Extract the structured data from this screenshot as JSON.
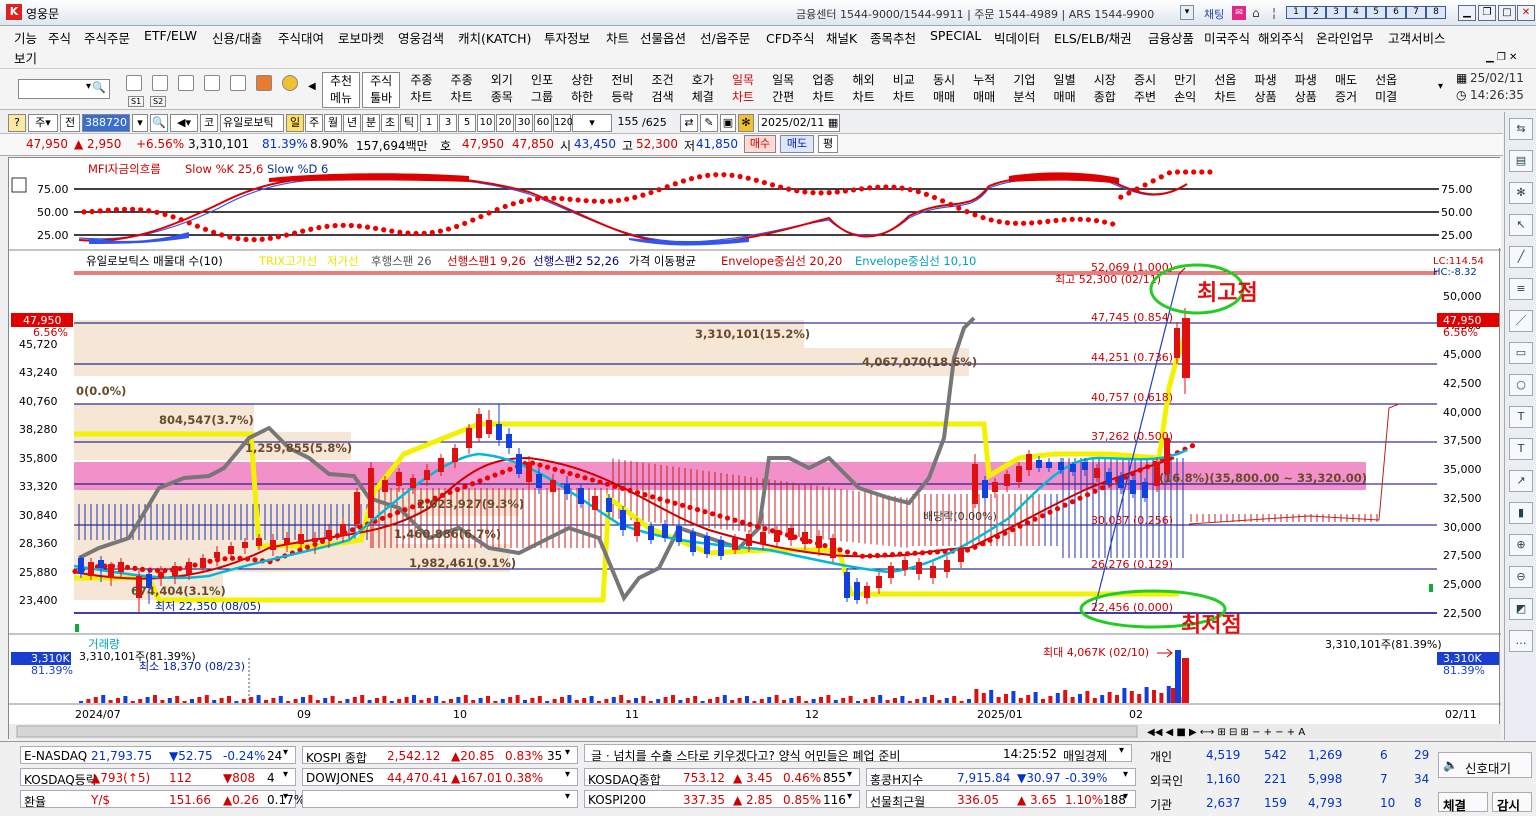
{
  "window": {
    "title": "영웅문",
    "info": "금융센터 1544-9000/1544-9911 | 주문 1544-4989 | ARS 1544-9900",
    "chat": "채팅",
    "num_buttons": [
      "1",
      "2",
      "3",
      "4",
      "5",
      "6",
      "7",
      "8"
    ]
  },
  "menu": {
    "items": [
      "기능",
      "주식",
      "주식주문",
      "ETF/ELW",
      "신용/대출",
      "주식대여",
      "로보마켓",
      "영웅검색",
      "캐치(KATCH)",
      "투자정보",
      "차트",
      "선물옵션",
      "선/옵주문",
      "CFD주식",
      "채널K",
      "종목추천",
      "SPECIAL",
      "빅데이터",
      "ELS/ELB/채권",
      "금융상품",
      "미국주식",
      "해외주식",
      "온라인업무",
      "고객서비스"
    ],
    "second": "보기"
  },
  "toolbar": {
    "small_labels": [
      "S1",
      "S2"
    ],
    "buttons": [
      "추천\n메뉴",
      "주식\n툴바",
      "주종\n차트",
      "주종\n차트",
      "외기\n종목",
      "인포\n그룹",
      "상한\n하한",
      "전비\n등락",
      "조건\n검색",
      "호가\n체결",
      "일목\n차트",
      "일목\n간편",
      "업종\n차트",
      "해외\n차트",
      "비교\n차트",
      "동시\n매매",
      "누적\n매매",
      "기업\n분석",
      "일별\n매매",
      "시장\n종합",
      "증시\n주변",
      "만기\n손익",
      "선옵\n차트",
      "파생\n상품",
      "파생\n상품",
      "매도\n증거",
      "선옵\n미결"
    ],
    "date": "25/02/11",
    "time": "14:26:35"
  },
  "ctrl": {
    "type": "주",
    "code": "388720",
    "name": "유일로보틱",
    "periods": [
      "일",
      "주",
      "월",
      "년",
      "분",
      "초",
      "틱"
    ],
    "nums": [
      "1",
      "3",
      "5",
      "10",
      "20",
      "30",
      "60",
      "120"
    ],
    "count": "155",
    "total": "/625",
    "date": "2025/02/11"
  },
  "price": {
    "last": "47,950",
    "chg": "▲ 2,950",
    "pct": "+6.56%",
    "vol": "3,310,101",
    "volpct": "81.39%",
    "turn": "8.90%",
    "amt": "157,694백만",
    "ho_label": "호",
    "ask": "47,950",
    "bid": "47,850",
    "open_l": "시",
    "open": "43,450",
    "high_l": "고",
    "high": "52,300",
    "low_l": "저",
    "low": "41,850",
    "buy": "매수",
    "sell": "매도",
    "flat": "평"
  },
  "panels": {
    "osc_title": "MFI자금의흐름",
    "osc_k": "Slow %K 25,6",
    "osc_d": "Slow %D 6",
    "osc_ticks": [
      "75.00",
      "50.00",
      "25.00"
    ],
    "main_legend": [
      {
        "t": "유일로보틱스 매물대 수(10)",
        "c": "#000000"
      },
      {
        "t": "TRIX고가선",
        "c": "#e6e600"
      },
      {
        "t": "저가선",
        "c": "#e6e600"
      },
      {
        "t": "후행스팬 26",
        "c": "#555555"
      },
      {
        "t": "선행스팬1 9,26",
        "c": "#cc0000"
      },
      {
        "t": "선행스팬2 52,26",
        "c": "#000080"
      },
      {
        "t": "가격 이동평균",
        "c": "#000000"
      },
      {
        "t": "Envelope중심선 20,20",
        "c": "#cc0000"
      },
      {
        "t": "Envelope중심선 10,10",
        "c": "#00a0c0"
      }
    ],
    "left_ticks": [
      "45,720",
      "43,240",
      "40,760",
      "38,280",
      "35,800",
      "33,320",
      "30,840",
      "28,360",
      "25,880",
      "23,400"
    ],
    "right_ticks": [
      "50,000",
      "47,500",
      "45,000",
      "42,500",
      "40,000",
      "37,500",
      "35,000",
      "32,500",
      "30,000",
      "27,500",
      "25,000",
      "22,500"
    ],
    "left_price": "47,950",
    "left_pct": "6.56%",
    "right_price": "47,950",
    "right_pct": "6.56%",
    "lc": "LC:114.54",
    "hc": "HC:-8.32",
    "fib": [
      "52,069 (1.000)",
      "47,745 (0.854)",
      "44,251 (0.736)",
      "40,757 (0.618)",
      "37,262 (0.500)",
      "30,037 (0.256)",
      "26,276 (0.129)",
      "22,456 (0.000)"
    ],
    "vp": [
      "3,310,101(15.2%)",
      "4,067,070(18.6%)",
      "0(0.0%)",
      "804,547(3.7%)",
      "1,259,855(5.8%)",
      "2,023,927(9.3%)",
      "1,460,886(6.7%)",
      "1,982,461(9.1%)",
      "674,404(3.1%)",
      "배당락(0.00%)"
    ],
    "zone": "(16.8%)(35,800.00 ~ 33,320.00)",
    "hi_label": "최고 52,300 (02/11)",
    "lo_label": "최저 22,350 (08/05)",
    "annot_hi": "최고점",
    "annot_lo": "최저점",
    "vol_title": "거래량",
    "vol_info": "3,310,101주(81.39%)",
    "vol_min": "최소 18,370 (08/23)",
    "vol_max": "최대 4,067K (02/10)",
    "vol_right": "3,310,101주(81.39%)",
    "vol_left_badge": "3,310K",
    "vol_left_pct": "81.39%",
    "vol_right_badge": "3,310K",
    "vol_right_pct": "81.39%",
    "xlabels": [
      "2024/07",
      "09",
      "10",
      "11",
      "12",
      "2025/01",
      "02"
    ],
    "x_end": "02/11"
  },
  "bottom": {
    "rows": [
      {
        "n": "E-NASDAQ",
        "v": "21,793.75",
        "c": "▼52.75",
        "p": "-0.24%",
        "x": "24",
        "cls": "dn"
      },
      {
        "n": "KOSDAQ등락",
        "v": "▲793(↑5)",
        "c": "112",
        "p": "▼808",
        "x": "4",
        "cls": "up"
      },
      {
        "n": "환율",
        "v": "Y/$",
        "c": "151.66",
        "p": "▲0.26",
        "x": "0.17%",
        "cls": "up"
      }
    ],
    "rows2": [
      {
        "n": "KOSPI 종합",
        "v": "2,542.12",
        "c": "▲20.85",
        "p": "0.83%",
        "x": "35"
      },
      {
        "n": "DOWJONES",
        "v": "44,470.41",
        "c": "▲167.01",
        "p": "0.38%",
        "x": ""
      }
    ],
    "news": "글 · 넘치를 수출 스타로 키우겠다고? 양식 어민들은 폐업 준비",
    "news_time": "14:25:52",
    "news_src": "매일경제",
    "rows3": [
      {
        "n": "KOSDAQ종합",
        "v": "753.12",
        "c": "▲ 3.45",
        "p": "0.46%",
        "x": "855"
      },
      {
        "n": "KOSPI200",
        "v": "337.35",
        "c": "▲ 2.85",
        "p": "0.85%",
        "x": "116"
      }
    ],
    "rows4": [
      {
        "n": "홍콩H지수",
        "v": "7,915.84",
        "c": "▼30.97",
        "p": "-0.39%",
        "x": ""
      },
      {
        "n": "선물최근월",
        "v": "336.05",
        "c": "▲ 3.65",
        "p": "1.10%",
        "x": "188"
      }
    ],
    "inv": [
      {
        "n": "개인",
        "a": "4,519",
        "b": "542",
        "c": "1,269",
        "d": "6",
        "e": "29"
      },
      {
        "n": "외국인",
        "a": "1,160",
        "b": "221",
        "c": "5,998",
        "d": "7",
        "e": "34"
      },
      {
        "n": "기관",
        "a": "2,637",
        "b": "159",
        "c": "4,793",
        "d": "10",
        "e": "8"
      }
    ],
    "signal": "신호대기",
    "settle": "체결",
    "watch": "감시"
  },
  "right_icons": [
    "refresh-icon",
    "layout-icon",
    "gear-icon",
    "cursor-icon",
    "trendline-icon",
    "fibo-icon",
    "line-icon",
    "rect-icon",
    "circle-icon",
    "text-icon",
    "text2-icon",
    "arrow-icon",
    "bars-icon",
    "zoomin-icon",
    "zoomout-icon",
    "chart-icon",
    "more-icon"
  ]
}
